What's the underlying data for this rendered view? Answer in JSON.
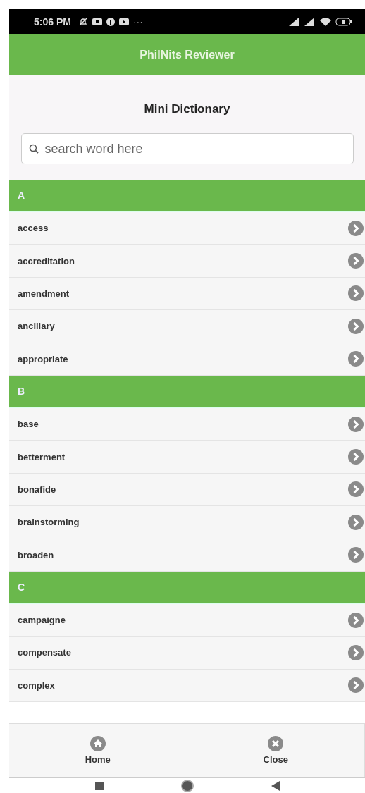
{
  "status_bar": {
    "time": "5:06 PM",
    "more": "···"
  },
  "app_bar": {
    "title": "PhilNits Reviewer"
  },
  "page_title": "Mini Dictionary",
  "search": {
    "placeholder": "search word here"
  },
  "sections": [
    {
      "letter": "A",
      "words": [
        "access",
        "accreditation",
        "amendment",
        "ancillary",
        "appropriate"
      ]
    },
    {
      "letter": "B",
      "words": [
        "base",
        "betterment",
        "bonafide",
        "brainstorming",
        "broaden"
      ]
    },
    {
      "letter": "C",
      "words": [
        "campaigne",
        "compensate",
        "complex"
      ]
    }
  ],
  "footer": [
    {
      "kind": "home",
      "label": "Home"
    },
    {
      "kind": "close",
      "label": "Close"
    }
  ]
}
